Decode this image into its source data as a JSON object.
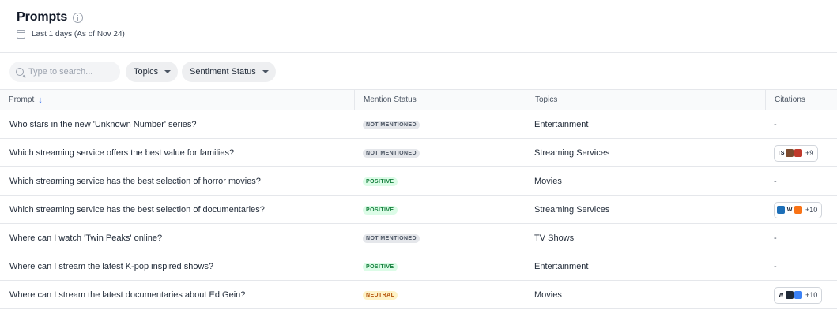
{
  "header": {
    "title": "Prompts",
    "date_range": "Last 1 days (As of Nov 24)"
  },
  "toolbar": {
    "search_placeholder": "Type to search...",
    "filters": [
      "Topics",
      "Sentiment Status"
    ]
  },
  "table": {
    "columns": [
      "Prompt",
      "Mention Status",
      "Topics",
      "Citations"
    ],
    "sorted_column": "Prompt",
    "sort_direction": "descending",
    "rows": [
      {
        "prompt": "Who stars in the new 'Unknown Number' series?",
        "mention_status": "NOT MENTIONED",
        "topic": "Entertainment",
        "citations": "-",
        "favicons": [],
        "more": ""
      },
      {
        "prompt": "Which streaming service offers the best value for families?",
        "mention_status": "NOT MENTIONED",
        "topic": "Streaming Services",
        "citations": "",
        "favicons": [
          {
            "icon": "ts-icon",
            "text": "TS",
            "color": "#ffffff",
            "fg": "#111827"
          },
          {
            "icon": "avatar-icon",
            "text": "",
            "color": "#7c4a2d",
            "fg": "#ffffff"
          },
          {
            "icon": "grid-icon",
            "text": "",
            "color": "#c0392b",
            "fg": "#ffffff"
          }
        ],
        "more": "+9"
      },
      {
        "prompt": "Which streaming service has the best selection of horror movies?",
        "mention_status": "POSITIVE",
        "topic": "Movies",
        "citations": "-",
        "favicons": [],
        "more": ""
      },
      {
        "prompt": "Which streaming service has the best selection of documentaries?",
        "mention_status": "POSITIVE",
        "topic": "Streaming Services",
        "citations": "",
        "favicons": [
          {
            "icon": "globe-icon",
            "text": "",
            "color": "#1d6fb8",
            "fg": "#ffffff"
          },
          {
            "icon": "wikipedia-icon",
            "text": "W",
            "color": "#ffffff",
            "fg": "#111827"
          },
          {
            "icon": "flame-icon",
            "text": "",
            "color": "#f97316",
            "fg": "#ffffff"
          }
        ],
        "more": "+10"
      },
      {
        "prompt": "Where can I watch 'Twin Peaks' online?",
        "mention_status": "NOT MENTIONED",
        "topic": "TV Shows",
        "citations": "-",
        "favicons": [],
        "more": ""
      },
      {
        "prompt": "Where can I stream the latest K-pop inspired shows?",
        "mention_status": "POSITIVE",
        "topic": "Entertainment",
        "citations": "-",
        "favicons": [],
        "more": ""
      },
      {
        "prompt": "Where can I stream the latest documentaries about Ed Gein?",
        "mention_status": "NEUTRAL",
        "topic": "Movies",
        "citations": "",
        "favicons": [
          {
            "icon": "wikipedia-icon",
            "text": "W",
            "color": "#ffffff",
            "fg": "#111827"
          },
          {
            "icon": "dark-square-icon",
            "text": "",
            "color": "#1f2937",
            "fg": "#ffffff"
          },
          {
            "icon": "blue-square-icon",
            "text": "",
            "color": "#3b82f6",
            "fg": "#ffffff"
          }
        ],
        "more": "+10"
      }
    ]
  },
  "colors": {
    "positive_bg": "#dcfce7",
    "positive_fg": "#15803d",
    "neutral_bg": "#fef3c7",
    "neutral_fg": "#b45309",
    "not_mentioned_bg": "#e5e7eb",
    "not_mentioned_fg": "#4b5563",
    "sort_arrow": "#2563eb"
  }
}
